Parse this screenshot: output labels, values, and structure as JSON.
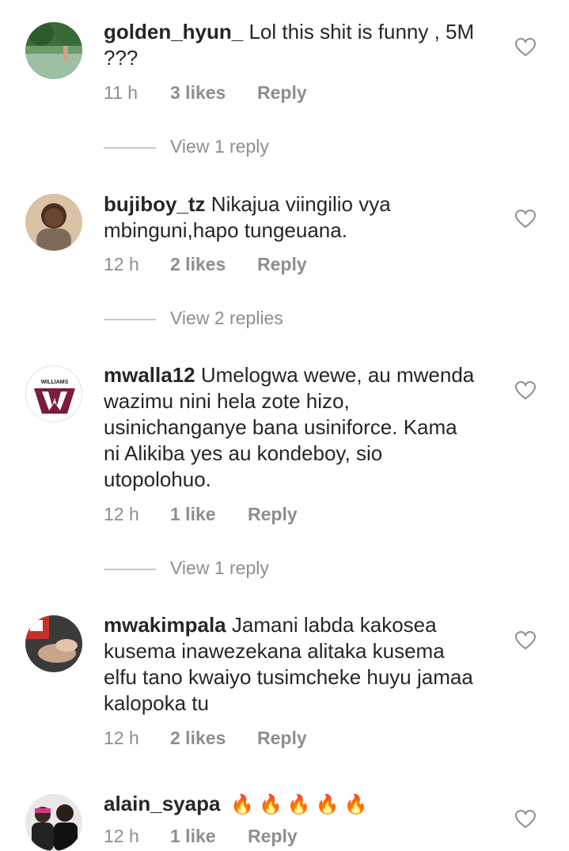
{
  "comments": [
    {
      "username": "golden_hyun_",
      "text": " Lol this shit is funny , 5M ???",
      "time": "11 h",
      "likes": "3 likes",
      "reply": "Reply",
      "view_replies": "View 1 reply",
      "avatar_icon": "landscape-photo-avatar"
    },
    {
      "username": "bujiboy_tz",
      "text": " Nikajua viingilio vya mbinguni,hapo tungeuana.",
      "time": "12 h",
      "likes": "2 likes",
      "reply": "Reply",
      "view_replies": "View 2 replies",
      "avatar_icon": "person-photo-avatar"
    },
    {
      "username": "mwalla12",
      "text": " Umelogwa wewe, au mwenda wazimu nini hela zote hizo, usinichanganye bana usiniforce. Kama ni Alikiba yes au kondeboy, sio utopolohuo.",
      "time": "12 h",
      "likes": "1 like",
      "reply": "Reply",
      "view_replies": "View 1 reply",
      "avatar_icon": "williams-logo-avatar",
      "avatar_logo_text": "WILLIAMS"
    },
    {
      "username": "mwakimpala",
      "text": " Jamani labda kakosea kusema inawezekana alitaka kusema elfu tano kwaiyo tusimcheke huyu jamaa kalopoka tu",
      "time": "12 h",
      "likes": "2 likes",
      "reply": "Reply",
      "avatar_icon": "photo-avatar"
    },
    {
      "username": "alain_syapa",
      "text": " 🔥🔥🔥🔥🔥",
      "time": "12 h",
      "likes": "1 like",
      "reply": "Reply",
      "avatar_icon": "two-people-photo-avatar"
    }
  ],
  "colors": {
    "text": "#262626",
    "secondary": "#8e8e8e",
    "divider": "#c7c7c7",
    "heart": "#8e8e8e"
  }
}
